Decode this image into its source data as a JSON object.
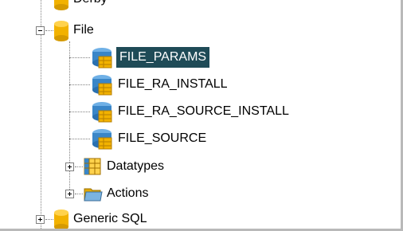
{
  "tree": {
    "top_partial_label": "Derby",
    "file_label": "File",
    "children": [
      {
        "label": "FILE_PARAMS",
        "icon": "table-icon",
        "selected": true
      },
      {
        "label": "FILE_RA_INSTALL",
        "icon": "table-icon"
      },
      {
        "label": "FILE_RA_SOURCE_INSTALL",
        "icon": "table-icon"
      },
      {
        "label": "FILE_SOURCE",
        "icon": "table-icon"
      }
    ],
    "datatypes_label": "Datatypes",
    "actions_label": "Actions",
    "generic_sql_label": "Generic SQL"
  },
  "colors": {
    "selection": "#1f4b57",
    "cylinder_gold": "#f2b200",
    "table_blue": "#3a86c8"
  }
}
